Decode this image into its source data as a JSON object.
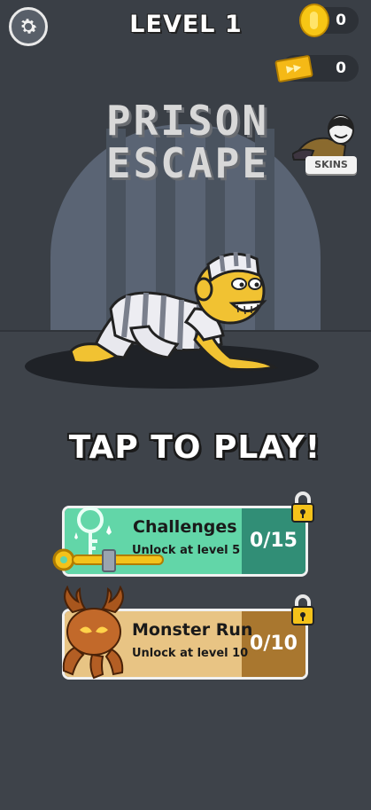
{
  "header": {
    "level_label": "LEVEL 1",
    "coins": "0",
    "tickets": "0",
    "ticket_icon_text": "▶▶"
  },
  "logo": {
    "line1": "PRISON",
    "line2": "ESCAPE"
  },
  "skins_label": "SKINS",
  "tap_to_play": "TAP TO PLAY!",
  "modes": [
    {
      "title": "Challenges",
      "subtitle": "Unlock at level 5",
      "progress": "0/15",
      "locked": true
    },
    {
      "title": "Monster Run",
      "subtitle": "Unlock at level 10",
      "progress": "0/10",
      "locked": true
    }
  ],
  "icons": [
    "gear-icon",
    "coin-icon",
    "ticket-icon",
    "lock-icon",
    "key-icon",
    "monster-icon",
    "prisoner-character",
    "skin-character"
  ],
  "colors": {
    "challenges_left": "#62d6a8",
    "challenges_right": "#318e76",
    "monster_left": "#e8c484",
    "monster_right": "#a9772f",
    "coin": "#f7c615"
  }
}
